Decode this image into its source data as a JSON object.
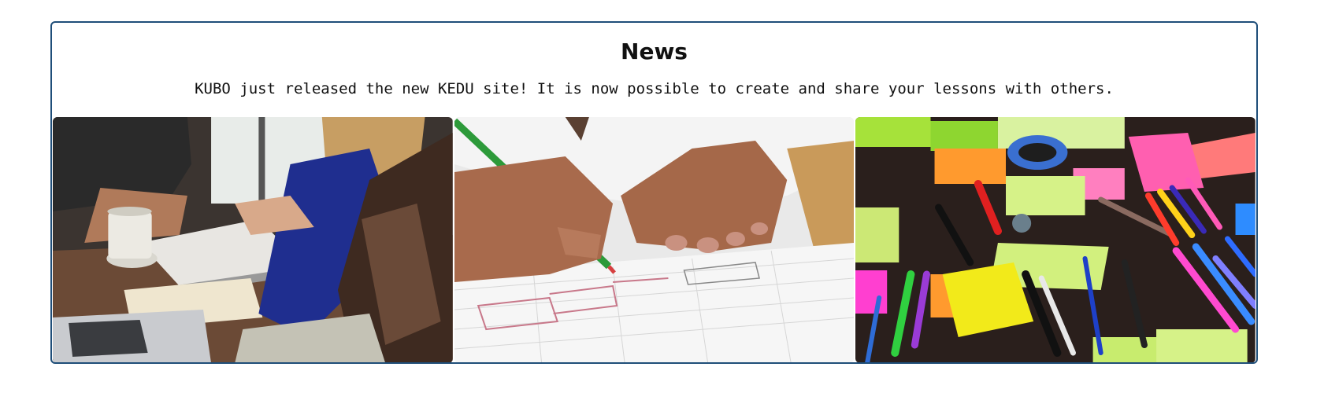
{
  "news": {
    "title": "News",
    "text": "KUBO just released the new KEDU site! It is now possible to create and share your lessons with others."
  },
  "gallery": [
    {
      "name": "students-studying-photo",
      "subject": "people studying at a table with laptop, notebook and coffee cup"
    },
    {
      "name": "child-drawing-photo",
      "subject": "child's hand drawing with a pencil on grid paper"
    },
    {
      "name": "sticky-notes-markers-photo",
      "subject": "colorful sticky notes and markers on a dark table"
    }
  ],
  "colors": {
    "border": "#1f4e79",
    "text": "#111111"
  }
}
